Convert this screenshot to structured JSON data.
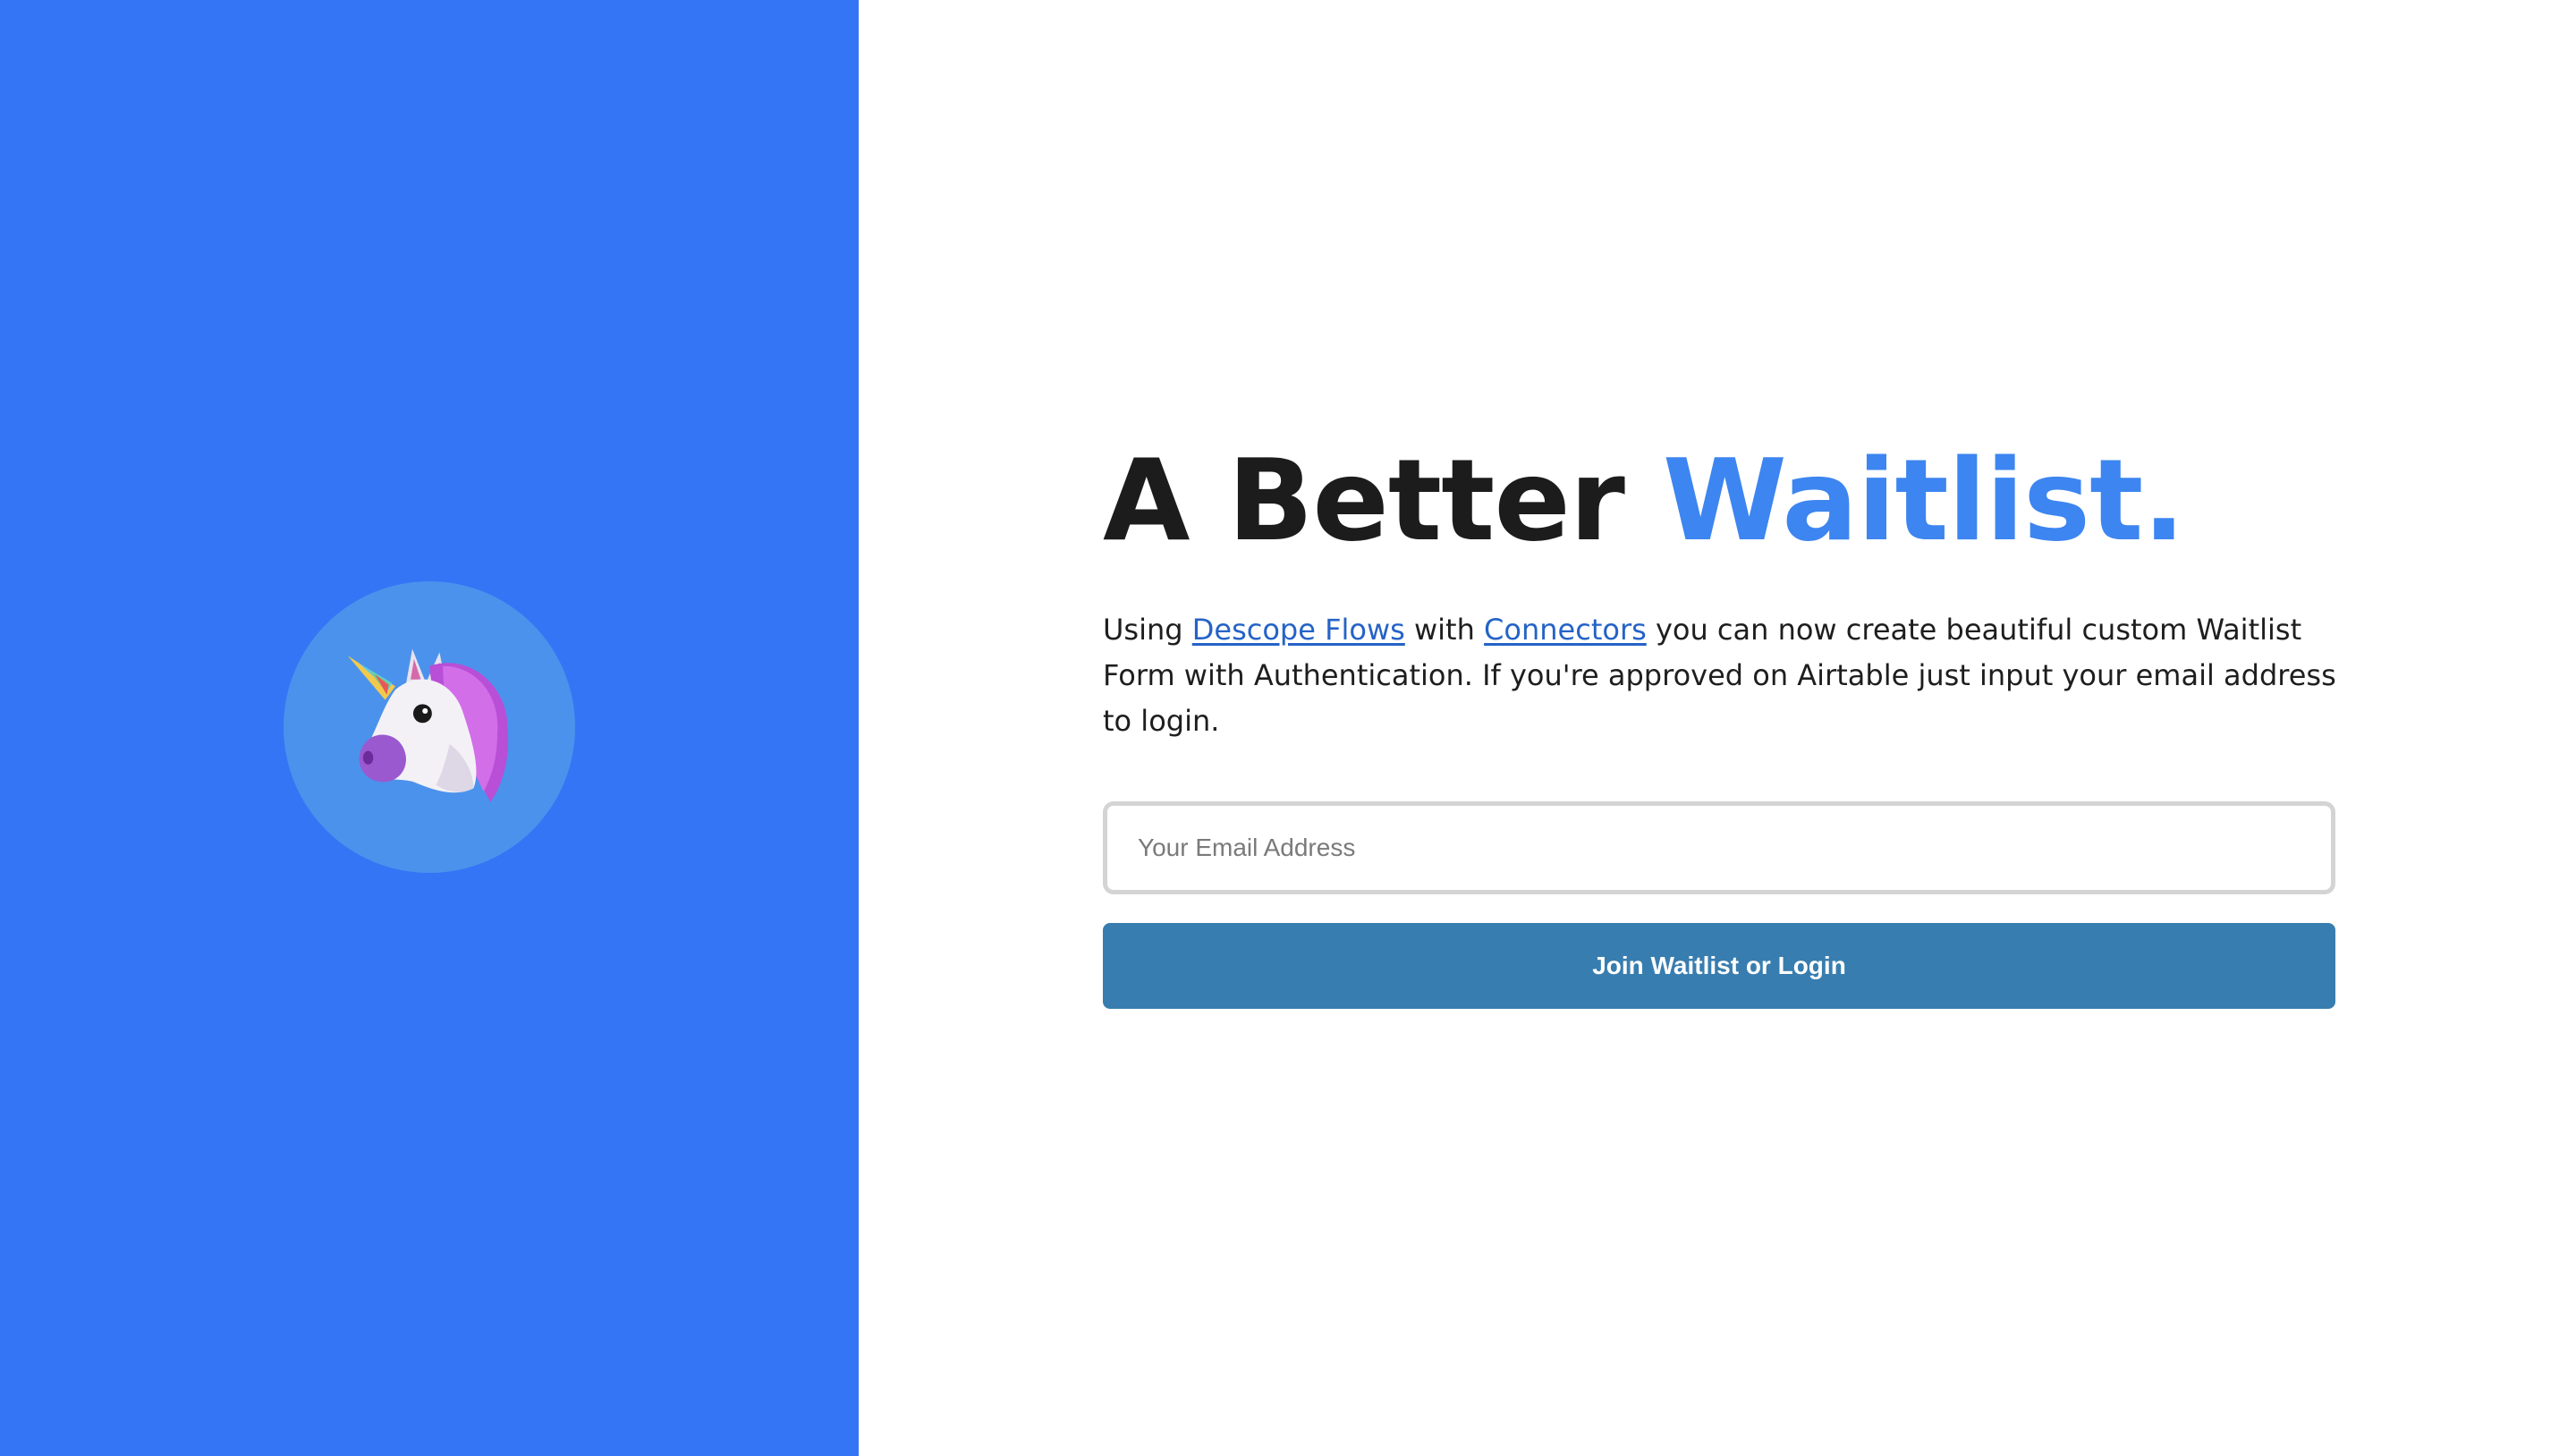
{
  "hero": {
    "icon": "unicorn-icon",
    "background_color": "#3475f6",
    "circle_color": "#4b92ec"
  },
  "headline": {
    "text_plain": "A Better ",
    "text_accent": "Waitlist.",
    "accent_color": "#3d85f0"
  },
  "description": {
    "part1": "Using ",
    "link1": "Descope Flows",
    "part2": " with ",
    "link2": "Connectors",
    "part3": " you can now create beautiful custom Waitlist Form with Authentication. If you're approved on Airtable just input your email address to login."
  },
  "form": {
    "email_placeholder": "Your Email Address",
    "email_value": "",
    "submit_label": "Join Waitlist or Login",
    "submit_color": "#387daf"
  }
}
